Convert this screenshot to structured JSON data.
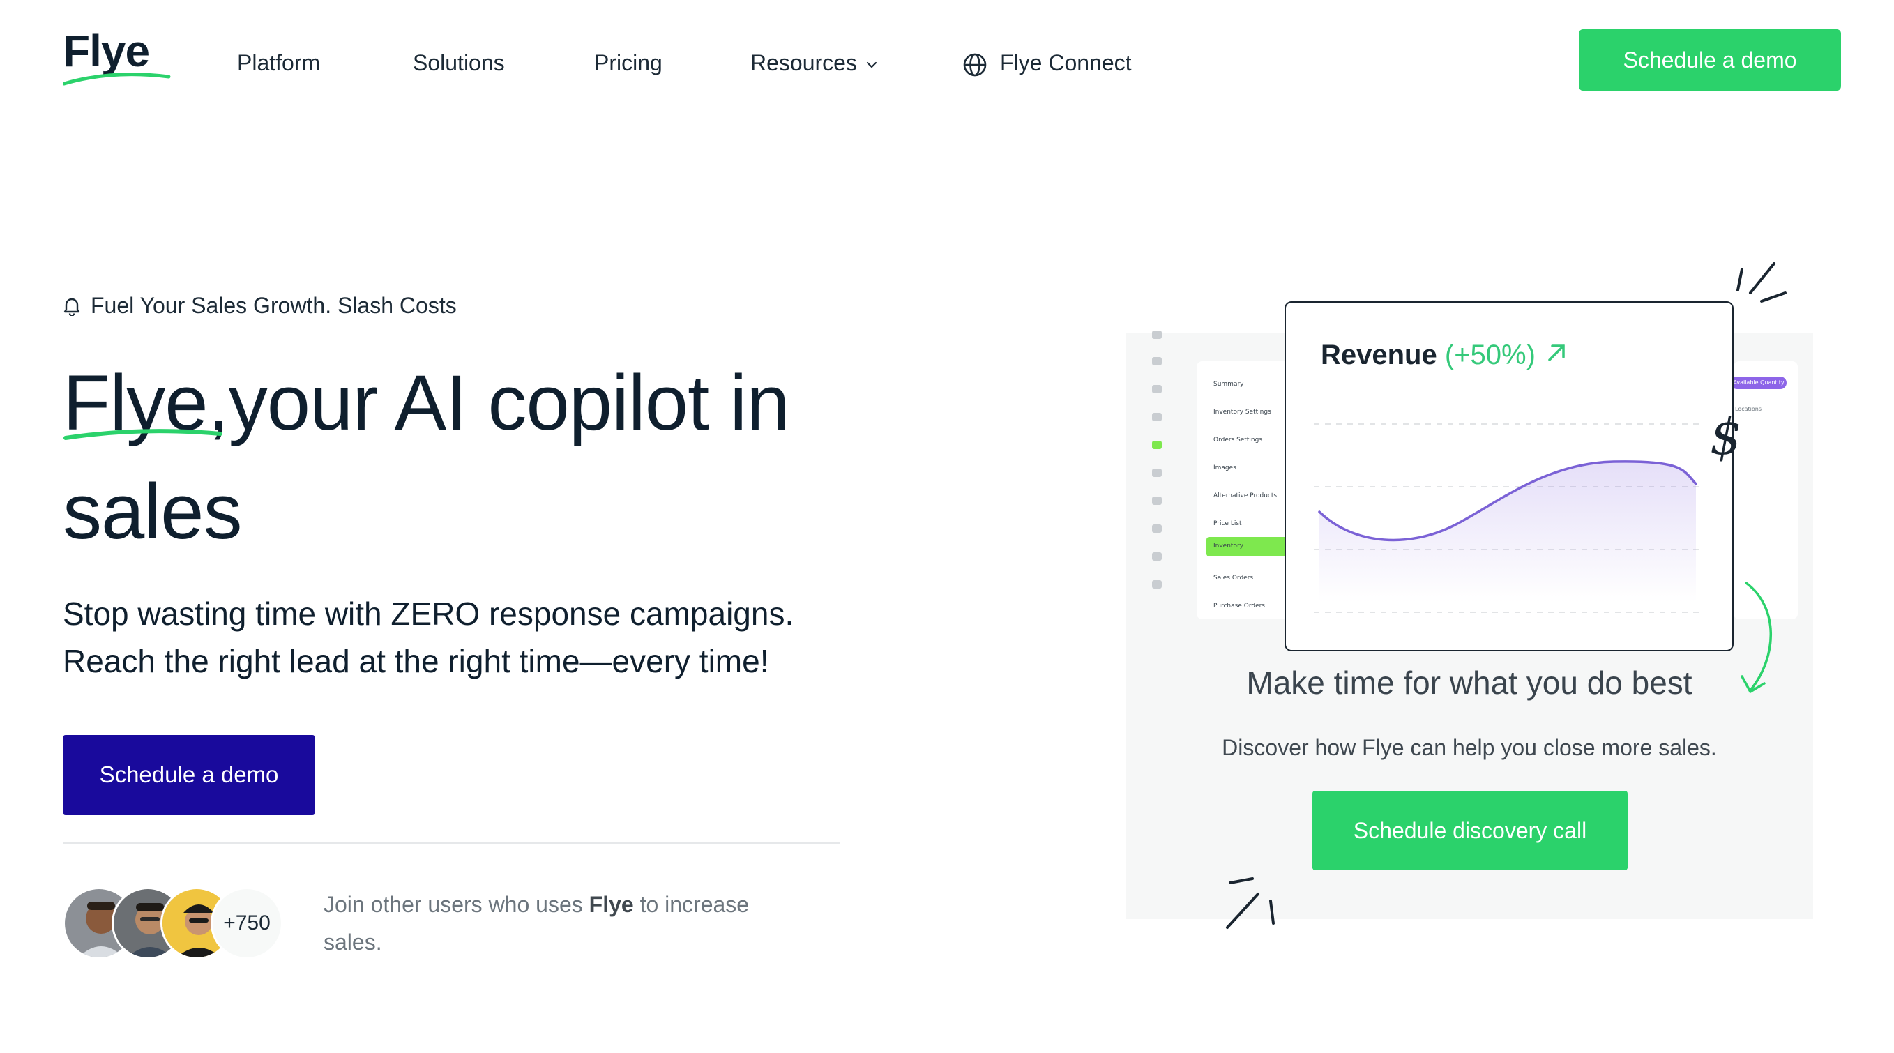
{
  "header": {
    "logo_text": "Flye",
    "nav": [
      {
        "label": "Platform"
      },
      {
        "label": "Solutions"
      },
      {
        "label": "Pricing"
      },
      {
        "label": "Resources"
      }
    ],
    "connect_label": "Flye Connect",
    "cta_label": "Schedule a demo"
  },
  "hero": {
    "eyebrow": "Fuel Your Sales Growth. Slash Costs",
    "headline_brand": "Flye,",
    "headline_rest": "your AI copilot in sales",
    "subhead": "Stop wasting time with ZERO response campaigns. Reach the right lead at the right time—every time!",
    "cta_label": "Schedule a demo",
    "social": {
      "count_badge": "+750",
      "text_before": "Join other users who uses",
      "brand": "Flye",
      "text_after": "to increase sales."
    }
  },
  "panel": {
    "mockup_menu": [
      "Summary",
      "Inventory Settings",
      "Orders Settings",
      "Images",
      "Alternative Products",
      "Price List",
      "Inventory",
      "Sales Orders",
      "Purchase Orders"
    ],
    "mockup_active_item": "Inventory",
    "mockup_tag": "Available Quantity",
    "mockup_right_label": "Locations",
    "card": {
      "title": "Revenue",
      "change": "(+50%)",
      "currency_symbol": "$"
    },
    "title": "Make time for what you do best",
    "subtitle": "Discover how Flye can help you close more sales.",
    "cta_label": "Schedule discovery call"
  },
  "colors": {
    "accent_green": "#2bd26b",
    "primary_blue": "#190a9c",
    "text_dark": "#0f1f2e",
    "chart_line": "#7b62d6"
  }
}
